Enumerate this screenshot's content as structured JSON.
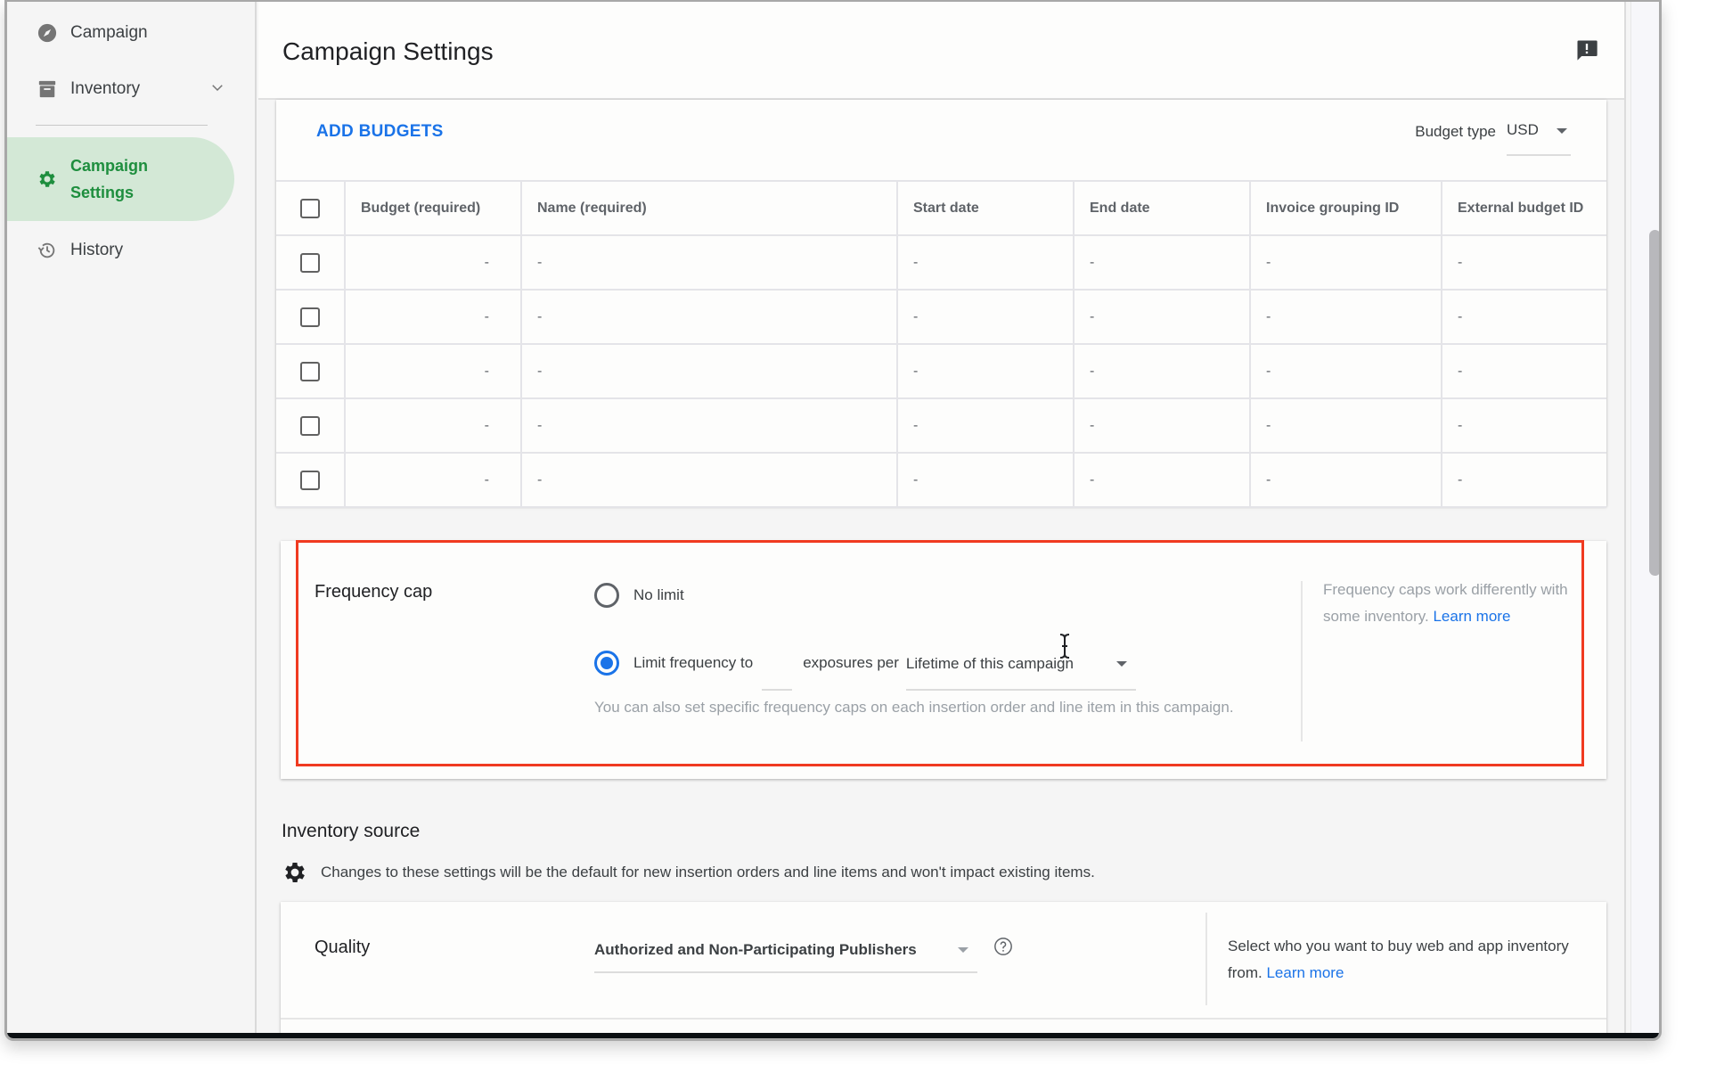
{
  "sidebar": {
    "items": [
      {
        "label": "Campaign",
        "icon": "compass-icon"
      },
      {
        "label": "Inventory",
        "icon": "archive-icon",
        "expandable": true
      },
      {
        "label_line1": "Campaign",
        "label_line2": "Settings",
        "icon": "gear-icon",
        "active": true
      },
      {
        "label": "History",
        "icon": "history-icon"
      }
    ]
  },
  "header": {
    "title": "Campaign Settings",
    "feedback_icon": "feedback-icon"
  },
  "budgets": {
    "add_label": "ADD BUDGETS",
    "budget_type_label": "Budget type",
    "budget_type_value": "USD",
    "columns": [
      "Budget (required)",
      "Name (required)",
      "Start date",
      "End date",
      "Invoice grouping ID",
      "External budget ID"
    ],
    "rows": [
      [
        "-",
        "-",
        "-",
        "-",
        "-",
        "-"
      ],
      [
        "-",
        "-",
        "-",
        "-",
        "-",
        "-"
      ],
      [
        "-",
        "-",
        "-",
        "-",
        "-",
        "-"
      ],
      [
        "-",
        "-",
        "-",
        "-",
        "-",
        "-"
      ],
      [
        "-",
        "-",
        "-",
        "-",
        "-",
        "-"
      ]
    ]
  },
  "frequency_cap": {
    "label": "Frequency cap",
    "options": [
      {
        "label": "No limit",
        "selected": false
      },
      {
        "label": "Limit frequency to",
        "selected": true
      }
    ],
    "limit_value": "",
    "exposures_label": "exposures per",
    "period_value": "Lifetime of this campaign",
    "help_text": "You can also set specific frequency caps on each insertion order and line item in this campaign.",
    "side_note": "Frequency caps work differently with some inventory.",
    "side_note_link": "Learn more",
    "highlight_color": "#f03a20"
  },
  "inventory_source": {
    "heading": "Inventory source",
    "note": "Changes to these settings will be the default for new insertion orders and line items and won't impact existing items.",
    "quality_label": "Quality",
    "quality_value": "Authorized and Non-Participating Publishers",
    "quality_side_note": "Select who you want to buy web and app inventory from.",
    "quality_side_note_link": "Learn more"
  },
  "colors": {
    "accent": "#1a73e8",
    "active_nav_bg": "#d3e8d6",
    "active_nav_text": "#1e8e3e"
  }
}
